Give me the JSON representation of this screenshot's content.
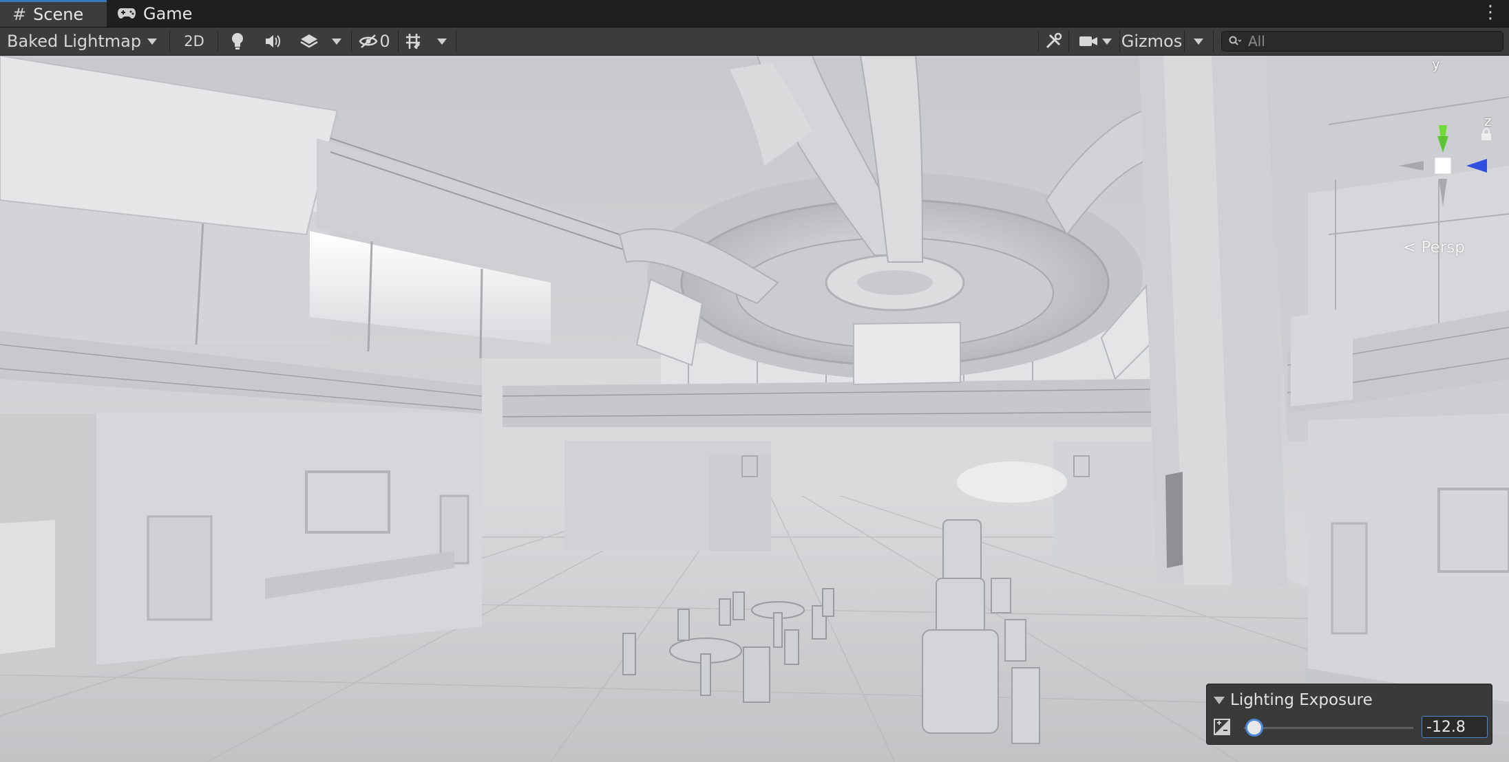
{
  "tabs": [
    {
      "label": "Scene",
      "icon": "grid-hash-icon",
      "active": true
    },
    {
      "label": "Game",
      "icon": "gamepad-icon",
      "active": false
    }
  ],
  "toolbar": {
    "draw_mode": "Baked Lightmap",
    "mode_2d": "2D",
    "hidden_count": "0",
    "gizmos_label": "Gizmos",
    "search_placeholder": "All"
  },
  "viewport": {
    "projection_label": "Persp",
    "axis_labels": {
      "y": "y",
      "z": "z"
    }
  },
  "overlay": {
    "title": "Lighting Exposure",
    "value": "-12.8",
    "slider_fraction": 0.06
  },
  "colors": {
    "accent": "#3a79bb",
    "axis_y": "#6fdc3c",
    "axis_z": "#2f4fe0",
    "panel_bg": "#3c3c3c"
  }
}
